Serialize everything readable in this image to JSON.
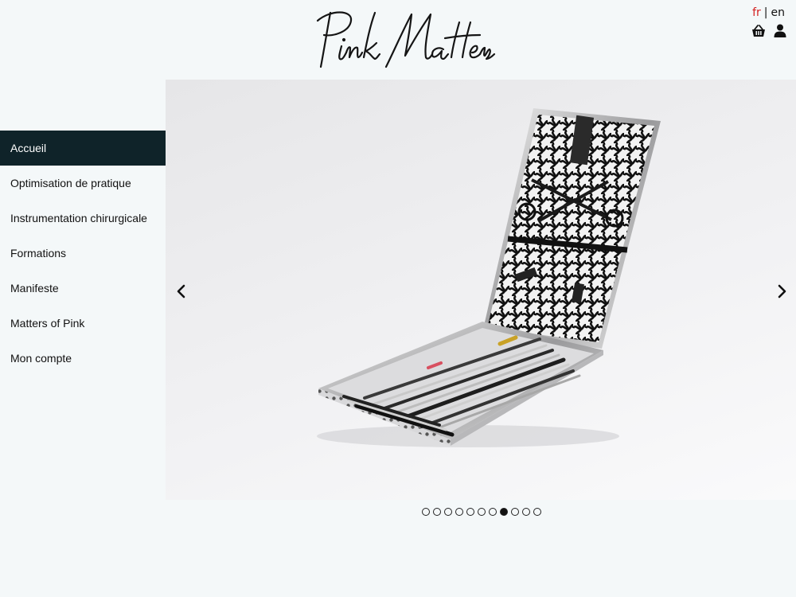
{
  "brand": {
    "logo_text": "Pink Matters"
  },
  "language": {
    "current": "fr",
    "separator": "|",
    "other": "en"
  },
  "header_icons": [
    "basket-icon",
    "user-icon"
  ],
  "nav": {
    "items": [
      {
        "label": "Accueil",
        "active": true
      },
      {
        "label": "Optimisation de pratique",
        "active": false
      },
      {
        "label": "Instrumentation chirurgicale",
        "active": false
      },
      {
        "label": "Formations",
        "active": false
      },
      {
        "label": "Manifeste",
        "active": false
      },
      {
        "label": "Matters of Pink",
        "active": false
      },
      {
        "label": "Mon compte",
        "active": false
      }
    ]
  },
  "carousel": {
    "slide_count": 11,
    "active_slide": 8,
    "image_alt": "",
    "prev_icon": "chevron-left-icon",
    "next_icon": "chevron-right-icon"
  },
  "colors": {
    "nav_active_bg": "#0f2329",
    "lang_active": "#d32020",
    "page_bg": "#f4f8f9"
  }
}
